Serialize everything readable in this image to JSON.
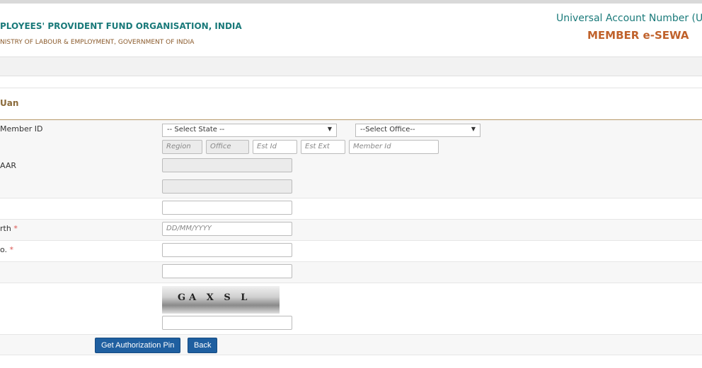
{
  "header": {
    "org_name": "PLOYEES' PROVIDENT FUND ORGANISATION, INDIA",
    "ministry": "NISTRY OF LABOUR & EMPLOYMENT, GOVERNMENT OF INDIA",
    "portal_title": "Universal Account Number (UA",
    "portal_subtitle": "MEMBER e-SEWA"
  },
  "panel": {
    "title": "Uan"
  },
  "form": {
    "member_id_label": "Member ID",
    "state_select": "-- Select State --",
    "office_select": "--Select Office--",
    "region_placeholder": "Region",
    "office_placeholder": "Office",
    "est_id_placeholder": "Est Id",
    "est_ext_placeholder": "Est Ext",
    "member_id_placeholder": "Member Id",
    "aadhaar_label": "AAR",
    "dob_label": "rth",
    "dob_placeholder": "DD/MM/YYYY",
    "mobile_label": "o.",
    "required_mark": "*",
    "captcha_text": "GA X S L"
  },
  "actions": {
    "get_pin": "Get Authorization Pin",
    "back": "Back"
  }
}
